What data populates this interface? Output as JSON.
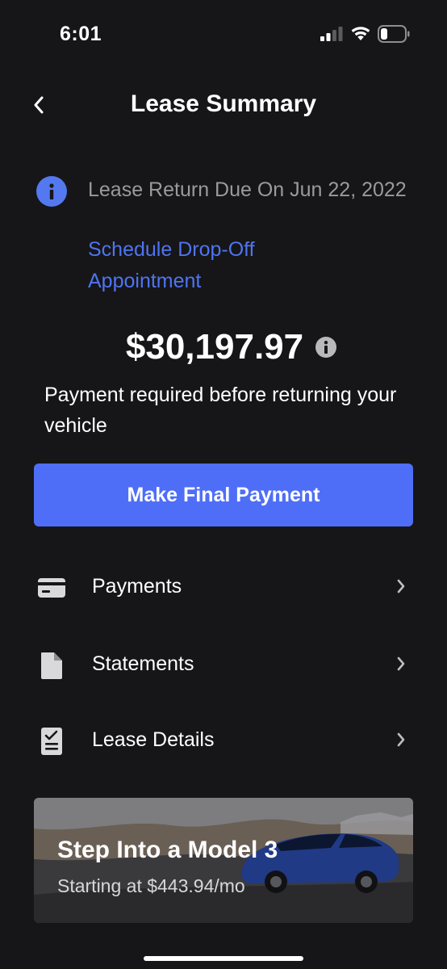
{
  "status_bar": {
    "time": "6:01"
  },
  "header": {
    "title": "Lease Summary"
  },
  "notice": {
    "text": "Lease Return Due On Jun 22, 2022",
    "link": "Schedule Drop-Off Appointment"
  },
  "balance": {
    "amount": "$30,197.97",
    "note": "Payment required before returning your vehicle"
  },
  "actions": {
    "final_payment_label": "Make Final Payment"
  },
  "menu": [
    {
      "label": "Payments",
      "icon": "credit-card-icon"
    },
    {
      "label": "Statements",
      "icon": "document-icon"
    },
    {
      "label": "Lease Details",
      "icon": "checklist-icon"
    }
  ],
  "promo": {
    "title": "Step Into a Model 3",
    "subtitle": "Starting at $443.94/mo"
  },
  "colors": {
    "background": "#161618",
    "accent": "#4f6ef7",
    "link": "#4f74f2",
    "info_badge": "#5478f0",
    "muted_text": "#9a9a9c"
  }
}
